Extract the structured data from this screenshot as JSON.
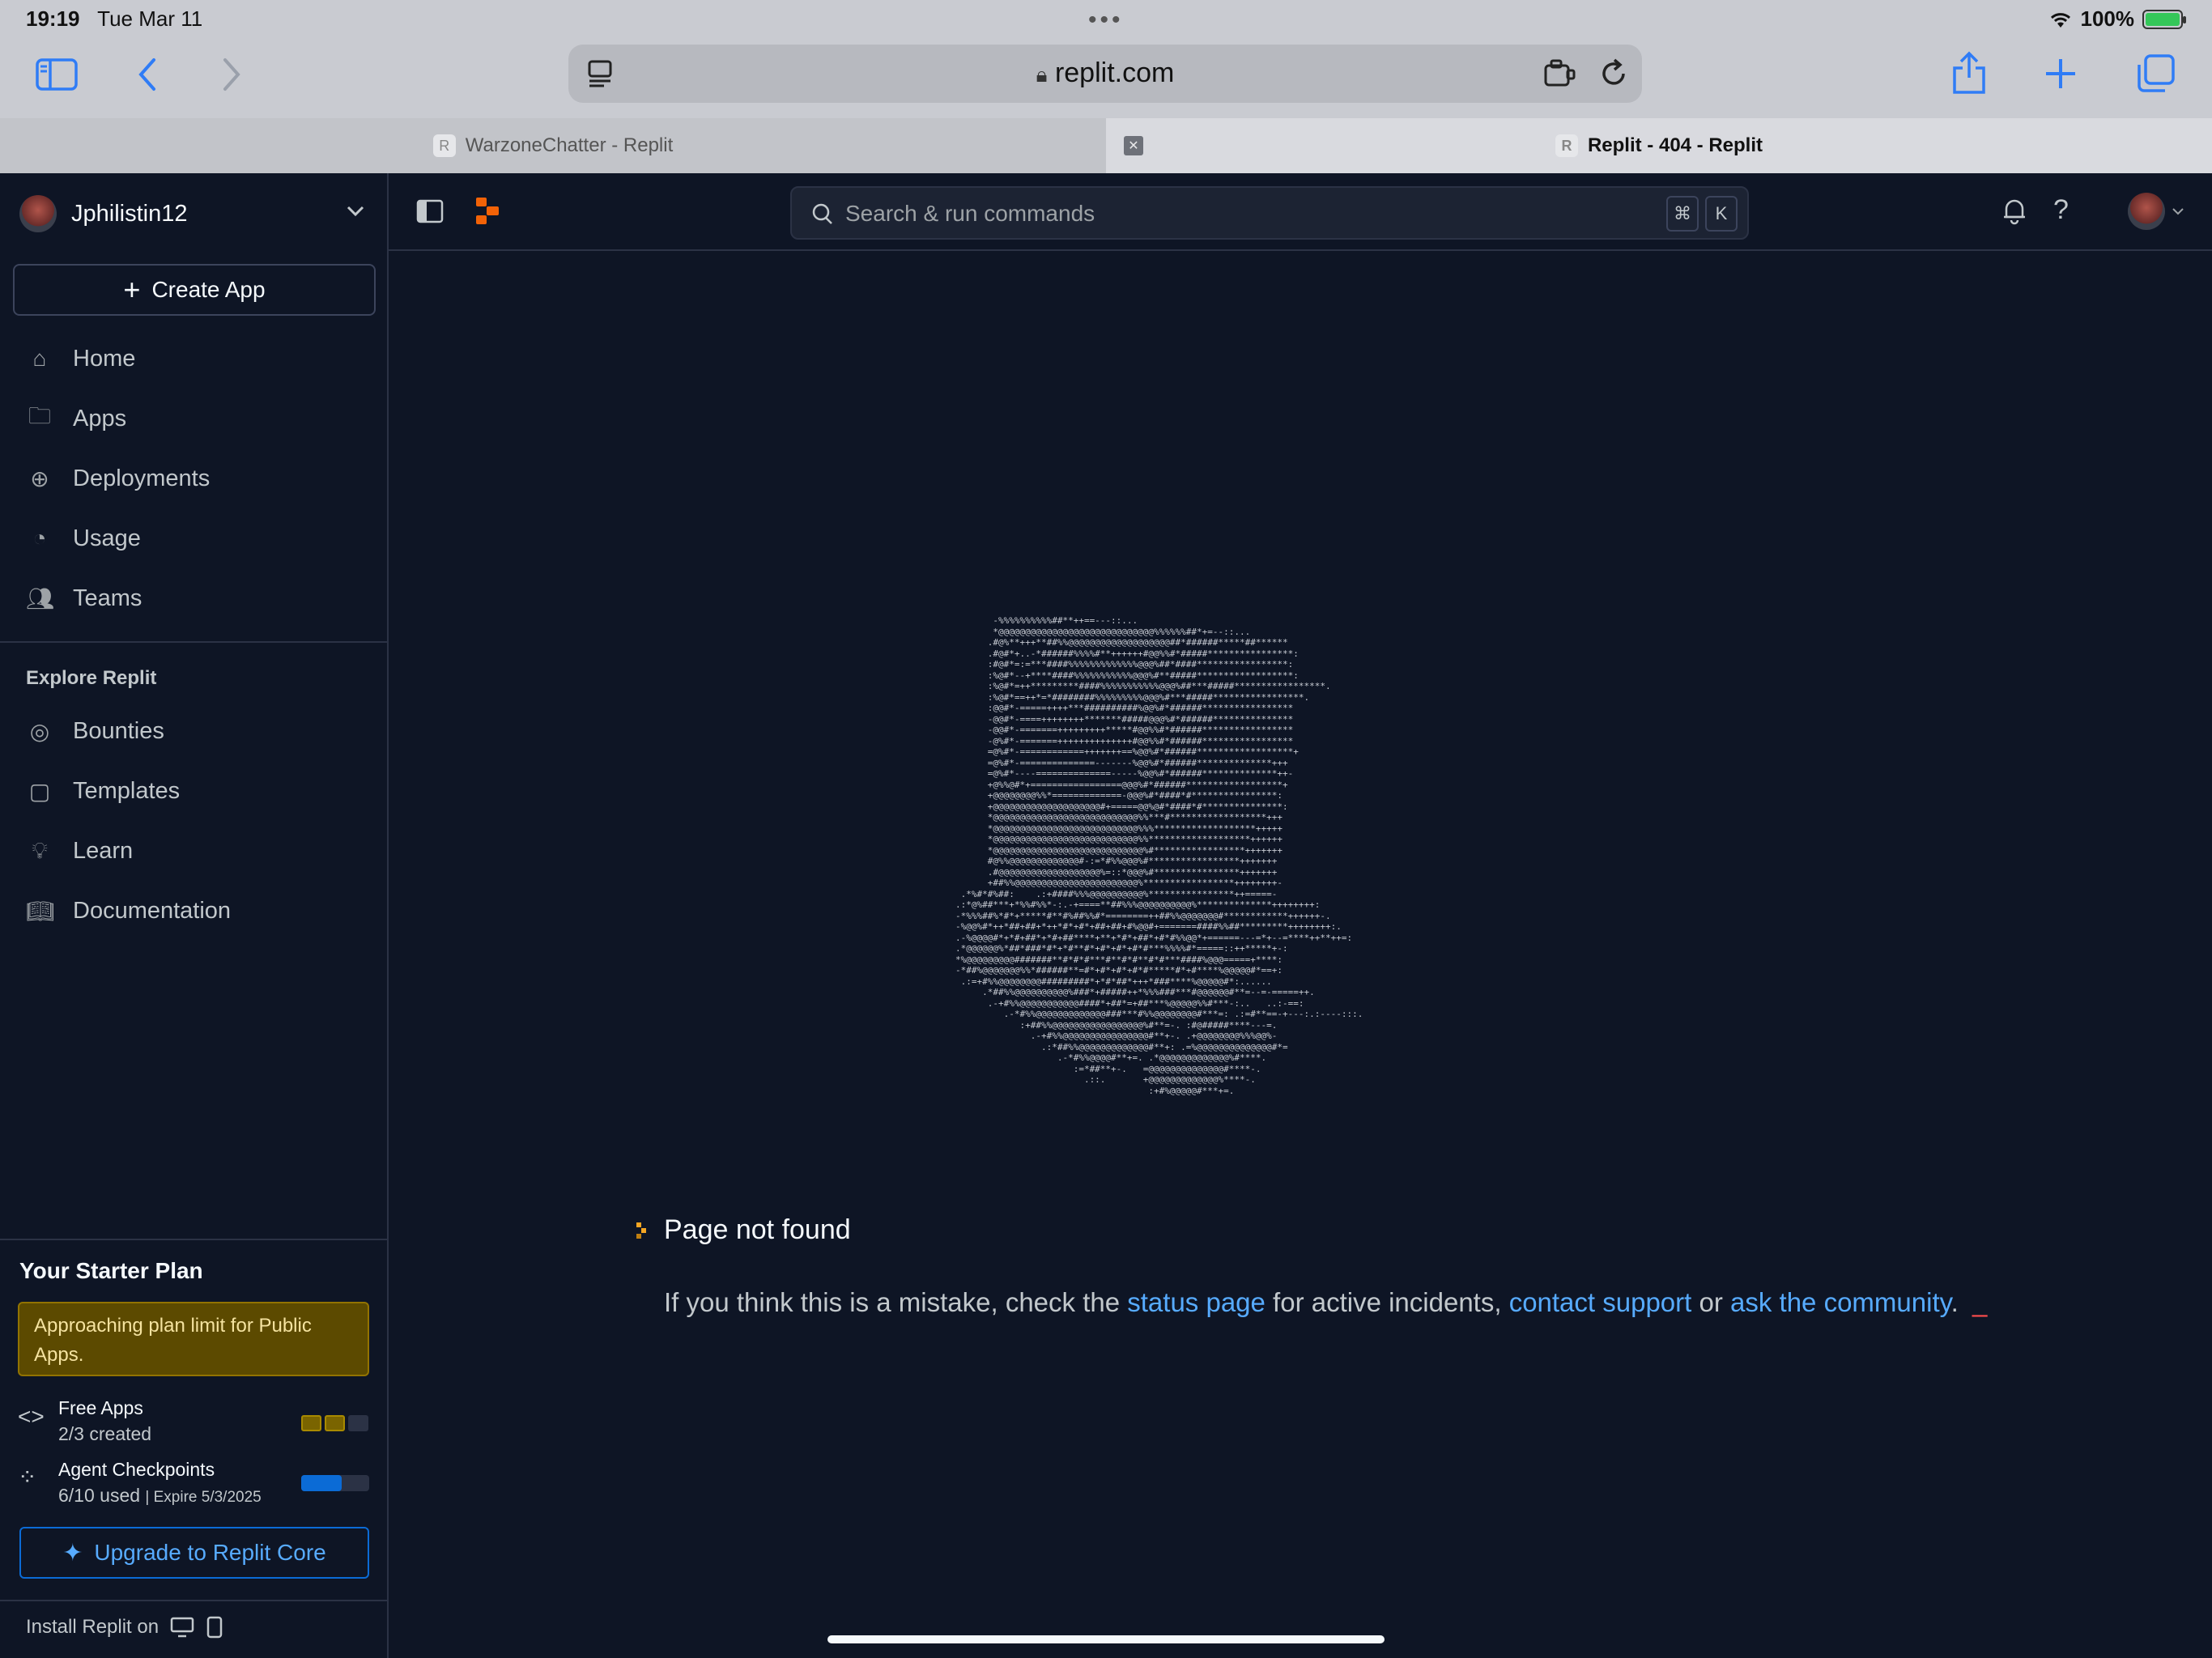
{
  "status_bar": {
    "time": "19:19",
    "date": "Tue Mar 11",
    "battery": "100%"
  },
  "browser": {
    "url": "replit.com",
    "tabs": [
      {
        "label": "WarzoneChatter - Replit",
        "favicon": "R",
        "active": false
      },
      {
        "label": "Replit - 404 - Replit",
        "favicon": "R",
        "active": true
      }
    ],
    "tab_close": "✕"
  },
  "sidebar": {
    "username": "Jphilistin12",
    "create_label": "Create App",
    "nav": [
      {
        "label": "Home",
        "icon": "home-icon"
      },
      {
        "label": "Apps",
        "icon": "folder-icon"
      },
      {
        "label": "Deployments",
        "icon": "deploy-icon"
      },
      {
        "label": "Usage",
        "icon": "gauge-icon"
      },
      {
        "label": "Teams",
        "icon": "users-icon"
      }
    ],
    "explore_title": "Explore Replit",
    "explore": [
      {
        "label": "Bounties",
        "icon": "target-icon"
      },
      {
        "label": "Templates",
        "icon": "template-icon"
      },
      {
        "label": "Learn",
        "icon": "bulb-icon"
      },
      {
        "label": "Documentation",
        "icon": "book-icon"
      }
    ],
    "plan": {
      "title": "Your Starter Plan",
      "warning": "Approaching plan limit for Public Apps.",
      "free_apps_label": "Free Apps",
      "free_apps_value": "2/3 created",
      "free_apps_used": 2,
      "free_apps_total": 3,
      "checkpoints_label": "Agent Checkpoints",
      "checkpoints_value": "6/10 used",
      "checkpoints_expire": "| Expire 5/3/2025",
      "checkpoints_fraction": 0.6,
      "upgrade_label": "Upgrade to Replit Core",
      "install_label": "Install Replit on"
    }
  },
  "topbar": {
    "search_placeholder": "Search & run commands",
    "kbd1": "⌘",
    "kbd2": "K"
  },
  "main": {
    "title": "Page not found",
    "msg_before": "If you think this is a mistake, check the ",
    "link_status": "status page",
    "msg_mid1": " for active incidents, ",
    "link_support": "contact support",
    "msg_mid2": " or ",
    "link_community": "ask the community",
    "msg_end": ".",
    "cursor": "_",
    "ascii_art": "       -%%%%%%%%%%##**++==---::...\n       *@@@@@@@@@@@@@@@@@@@@@@@@@@@@@%%%%%%##*+=--::...\n      .#@%**+++**##%%@@@@@@@@@@@@@@@@@@@##*######*****##******\n      .#@#*+..-*######%%%%#**++++++#@@%%#*#####****************:\n      :#@#*=:=***####%%%%%%%%%%%%%@@@%##*####*****************:\n      :%@#*--+****####%%%%%%%%%%%@@@%#**#####******************:\n      :%@#*=++*********####%%%%%%%%%%%@@@%##***#####*****************.\n      :%@#*==++*=*########%%%%%%%%%@@@%#***#####*****************.\n      :@@#*-=====++++***##########%@@%#*######*****************\n      -@@#*-====++++++++*******#####@@@%#*######***************\n      -@@#*-=======+++++++++*****#@@%%#*######*****************\n      -@%#*-=======++++++++++++++#@@%%#*######*****************\n      =@%#*-============+++++++==%@@%#*######******************+\n      =@%#*-==============-------%@@%#*######**************+++\n      =@%#*----==============-----%@@%#*######**************++-\n      +@%%@#*+=================@@@%#*######******************+\n      +@@@@@@@@%%*=============-@@@%#*####*#****************:\n      +@@@@@@@@@@@@@@@@@@@@#+=====@@%@#*####*#***************:\n      *@@@@@@@@@@@@@@@@@@@@@@@@@@@%%***#******************+++\n      *@@@@@@@@@@@@@@@@@@@@@@@@@@@%%%*******************+++++\n      *@@@@@@@@@@@@@@@@@@@@@@@@@@@%%*******************++++++\n      *@@@@@@@@@@@@@@@@@@@@@@@@@@@@%#*****************+++++++\n      #@%%@@@@@@@@@@@@@#-:=*#%%@@@%#*****************+++++++\n      .#@@@@@@@@@@@@@@@@@@@%=::*@@@%#****************+++++++\n      +##%%@@@@@@@@@@@@@@@@@@@@@@@%*****************++++++++-\n .*%#*#%##:    .:+####%%%@@@@@@@@@@%****************++=====-\n.:*@%##***+*%%#%%*-:.-+====**##%%%@@@@@@@@@@%**************++++++++:\n-*%%%##%*#*+*****#**#%##%%#*========++##%%@@@@@@@#************++++++-.\n-%@@%#*++*##+##+*++*#*+#*+##+##+#%@@#+=======####%%##*********++++++++:.\n.-%@@@@#*+*#+##*+*#+##****+**+*#*+##*+#*#%%@@*+======---=*+--=****++**++=:\n.*@@@@@@%*##*###*#*+*#**#*+#*+#*+#*#***%%%%#*=====::++*****+-:\n*%@@@@@@@@@#######**#*#*#***#**#*#**#*#***####%@@@=====+****:\n-*##%@@@@@@@%%*######**=#*+#*+#*+#*#*****#*+#****%@@@@@#*==+:\n .:=+#%%@@@@@@@@#########*+*#*##*+++*###****%@@@@@#*:......\n     .*##%%@@@@@@@@@@%###*+#####++*%%%###***#@@@@@@#**=--=-=====++.\n      .-+#%%@@@@@@@@@@@####*+##*=+##***%@@@@@%%#***-:..   ..:-==:\n         .-*#%%@@@@@@@@@@@@@###***#%%@@@@@@@@#***=: .:=#**==-+---:.:----:::.\n            :+##%%@@@@@@@@@@@@@@@@@%#**=-. :#@#####****---=.\n              .-+#%%@@@@@@@@@@@@@@@@#**+-. .+@@@@@@@@%%%@@%-\n                .:*##%%@@@@@@@@@@@@@#**+: .=%@@@@@@@@@@@@@@#*=\n                   .-*#%%@@@@#**+=. .*@@@@@@@@@@@@@%#****.\n                      :=*##**+-.   =@@@@@@@@@@@@@@#****-.\n                        .::.       +@@@@@@@@@@@@@%****-.\n                                    :+#%@@@@@#***+=."
  }
}
